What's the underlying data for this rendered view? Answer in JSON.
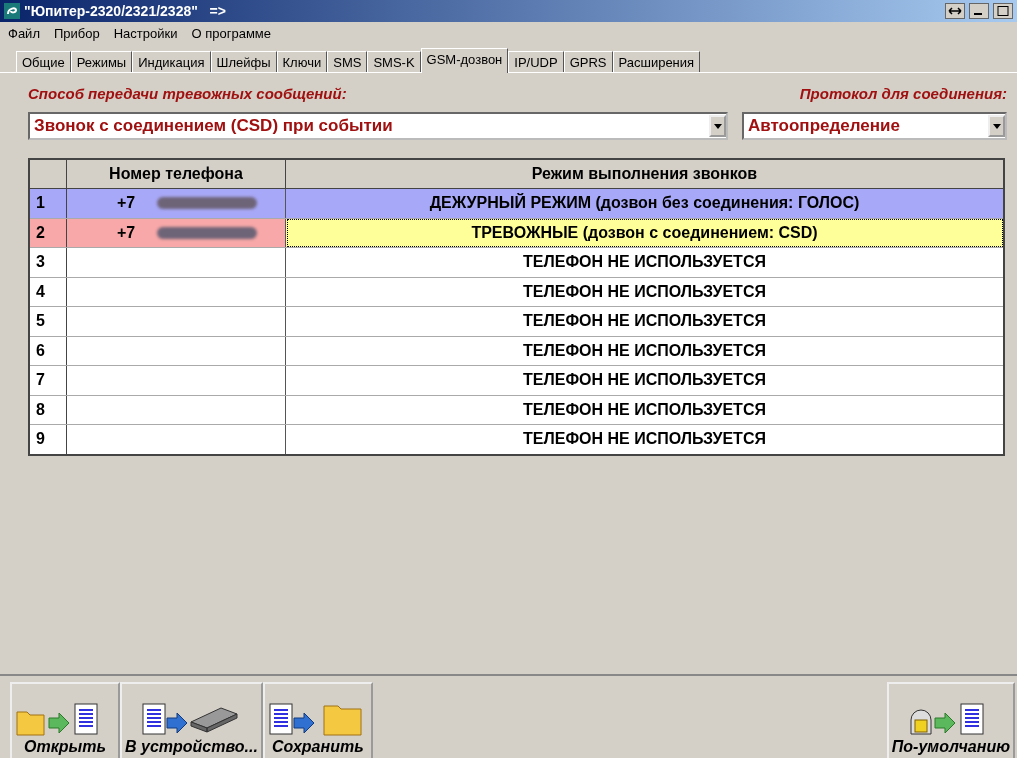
{
  "window": {
    "title": "\"Юпитер-2320/2321/2328\"   =>"
  },
  "menu": [
    "Файл",
    "Прибор",
    "Настройки",
    "О программе"
  ],
  "tabs": [
    {
      "label": "Общие",
      "selected": false
    },
    {
      "label": "Режимы",
      "selected": false
    },
    {
      "label": "Индикация",
      "selected": false
    },
    {
      "label": "Шлейфы",
      "selected": false
    },
    {
      "label": "Ключи",
      "selected": false
    },
    {
      "label": "SMS",
      "selected": false
    },
    {
      "label": "SMS-K",
      "selected": false
    },
    {
      "label": "GSM-дозвон",
      "selected": true
    },
    {
      "label": "IP/UDP",
      "selected": false
    },
    {
      "label": "GPRS",
      "selected": false
    },
    {
      "label": "Расширения",
      "selected": false
    }
  ],
  "transfer": {
    "label": "Способ передачи тревожных сообщений:",
    "value": "Звонок с соединением (CSD) при событии"
  },
  "protocol": {
    "label": "Протокол для соединения:",
    "value": "Автоопределение"
  },
  "table": {
    "columns": [
      "Номер телефона",
      "Режим выполнения звонков"
    ],
    "rows": [
      {
        "number": "1",
        "phone": "+7",
        "blurred": true,
        "mode": "ДЕЖУРНЫЙ РЕЖИМ (дозвон без соединения: ГОЛОС)",
        "color": "#a8a8f8",
        "selected": false
      },
      {
        "number": "2",
        "phone": "+7",
        "blurred": true,
        "mode": "ТРЕВОЖНЫЕ (дозвон с соединением: CSD)",
        "color": "#f8a8a8",
        "selected": true
      },
      {
        "number": "3",
        "mode": "ТЕЛЕФОН НЕ ИСПОЛЬЗУЕТСЯ",
        "selected": false
      },
      {
        "number": "4",
        "mode": "ТЕЛЕФОН НЕ ИСПОЛЬЗУЕТСЯ",
        "selected": false
      },
      {
        "number": "5",
        "mode": "ТЕЛЕФОН НЕ ИСПОЛЬЗУЕТСЯ",
        "selected": false
      },
      {
        "number": "6",
        "mode": "ТЕЛЕФОН НЕ ИСПОЛЬЗУЕТСЯ",
        "selected": false
      },
      {
        "number": "7",
        "mode": "ТЕЛЕФОН НЕ ИСПОЛЬЗУЕТСЯ",
        "selected": false
      },
      {
        "number": "8",
        "mode": "ТЕЛЕФОН НЕ ИСПОЛЬЗУЕТСЯ",
        "selected": false
      },
      {
        "number": "9",
        "mode": "ТЕЛЕФОН НЕ ИСПОЛЬЗУЕТСЯ",
        "selected": false
      }
    ]
  },
  "toolbar": [
    {
      "label": "Открыть",
      "kind": "open"
    },
    {
      "label": "В устройство...",
      "kind": "device"
    },
    {
      "label": "Сохранить",
      "kind": "save"
    }
  ],
  "default_button": {
    "label": "По-умолчанию"
  }
}
